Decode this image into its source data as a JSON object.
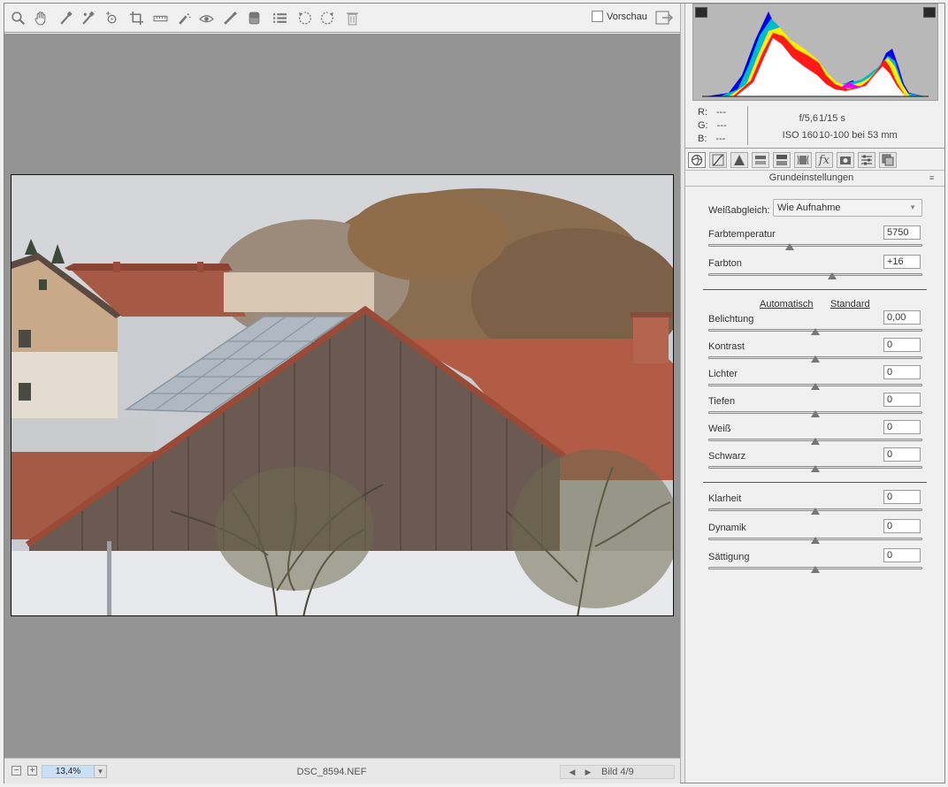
{
  "toolbar": {
    "tools": [
      "zoom-icon",
      "hand-icon",
      "white-balance-icon",
      "color-sampler-icon",
      "target-adjust-icon",
      "crop-icon",
      "straighten-icon",
      "spot-removal-icon",
      "red-eye-icon",
      "adjustment-brush-icon",
      "graduated-filter-icon",
      "preferences-icon",
      "rotate-left-icon",
      "rotate-right-icon",
      "trash-icon"
    ],
    "preview_label": "Vorschau",
    "preview_checked": false
  },
  "status": {
    "zoom": "13,4%",
    "filename": "DSC_8594.NEF",
    "image_position": "Bild 4/9"
  },
  "info": {
    "r_label": "R:",
    "r_value": "---",
    "g_label": "G:",
    "g_value": "---",
    "b_label": "B:",
    "b_value": "---",
    "aperture": "f/5,6",
    "shutter": "1/15 s",
    "iso": "ISO 160",
    "lens": "10-100 bei 53 mm"
  },
  "panel": {
    "tabs": [
      "basic-icon",
      "tone-curve-icon",
      "detail-icon",
      "hsl-icon",
      "split-toning-icon",
      "lens-corrections-icon",
      "effects-icon",
      "camera-calibration-icon",
      "presets-icon",
      "snapshots-icon"
    ],
    "title": "Grundeinstellungen",
    "white_balance_label": "Weißabgleich:",
    "white_balance_value": "Wie Aufnahme",
    "auto_label": "Automatisch",
    "default_label": "Standard",
    "sliders": {
      "temperature": {
        "label": "Farbtemperatur",
        "value": "5750",
        "level": 0.38
      },
      "tint": {
        "label": "Farbton",
        "value": "+16",
        "level": 0.58
      },
      "exposure": {
        "label": "Belichtung",
        "value": "0,00",
        "level": 0.5
      },
      "contrast": {
        "label": "Kontrast",
        "value": "0",
        "level": 0.5
      },
      "highlights": {
        "label": "Lichter",
        "value": "0",
        "level": 0.5
      },
      "shadows": {
        "label": "Tiefen",
        "value": "0",
        "level": 0.5
      },
      "whites": {
        "label": "Weiß",
        "value": "0",
        "level": 0.5
      },
      "blacks": {
        "label": "Schwarz",
        "value": "0",
        "level": 0.5
      },
      "clarity": {
        "label": "Klarheit",
        "value": "0",
        "level": 0.5
      },
      "vibrance": {
        "label": "Dynamik",
        "value": "0",
        "level": 0.5
      },
      "saturation": {
        "label": "Sättigung",
        "value": "0",
        "level": 0.5
      }
    }
  },
  "colors": {
    "canvas": "#949494",
    "zoom_highlight": "#cbe0f6",
    "histogram_bg": "#b8b8b8"
  }
}
